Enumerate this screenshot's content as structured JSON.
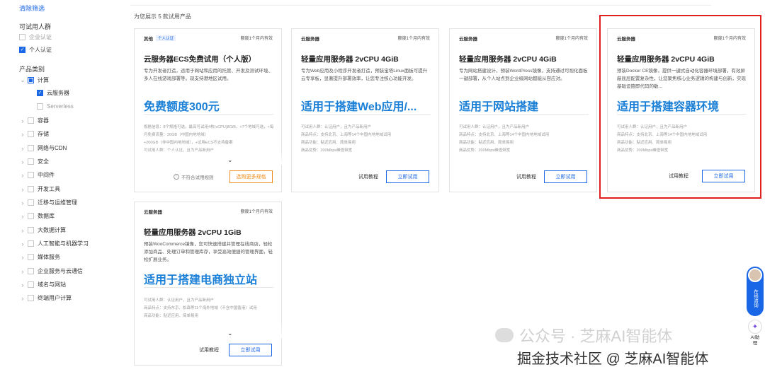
{
  "sidebar": {
    "clear_filters": "清除筛选",
    "audience_title": "可试用人群",
    "audience": [
      {
        "label": "企业认证",
        "checked": false
      },
      {
        "label": "个人认证",
        "checked": true
      }
    ],
    "category_title": "产品类别",
    "compute": {
      "label": "计算",
      "children": [
        {
          "label": "云服务器",
          "checked": true
        },
        {
          "label": "Serverless",
          "checked": false
        }
      ]
    },
    "categories": [
      "容器",
      "存储",
      "网络与CDN",
      "安全",
      "中间件",
      "开发工具",
      "迁移与运维管理",
      "数据库",
      "大数据计算",
      "人工智能与机器学习",
      "媒体服务",
      "企业服务与云通信",
      "域名与网站",
      "终端用户计算"
    ]
  },
  "content": {
    "count_text": "为您展示 5 款试用产品",
    "cards": [
      {
        "category": "其他",
        "tag": "个人认证",
        "quota": "额度1个月内有效",
        "title": "云服务器ECS免费试用（个人版）",
        "desc": "专为开发者打造，适用于网站和应用的托管、开发及测试环境、多人在线游戏部署等。现支持港地区试用。",
        "headline": "免费额度300元",
        "features": [
          "规格信息：8个规格可选，最高可试用4核(vCPU)8GiB，+7个地域可选，+每月免费流量：20GB（中国内地地域）",
          "+200GB（非中国内地地域），+试用ECS不支持备案",
          "可试用人群：个人认证，且为产品新用户"
        ],
        "rules_link": "不符合试用规则",
        "action": "选购更多规格"
      },
      {
        "category": "云服务器",
        "quota": "额度1个月内有效",
        "title": "轻量应用服务器 2vCPU 4GiB",
        "desc": "专为Web应用及小程序开发者打造，预装宝塔Linux面板可提升云专享板，显著提升部署效率，让您专注核心功能开发。",
        "headline": "适用于搭建Web应用/...",
        "features": [
          "可试用人群：认证用户，且为产品新用户",
          "商品特点：支持北京、上海等14个中国内地地域试用",
          "商品功能：贴近应用、简单易用",
          "商品优势：200Mbps峰值带宽"
        ],
        "guide": "试用教程",
        "action": "立即试用"
      },
      {
        "category": "云服务器",
        "quota": "额度1个月内有效",
        "title": "轻量应用服务器 2vCPU 4GiB",
        "desc": "专为网站搭建设计，预装WordPress镜像，支持通过可视化面板一键部署，从个人站点到企业级网站都能从容应对。",
        "headline": "适用于网站搭建",
        "features": [
          "可试用人群：认证用户，且为产品新用户",
          "商品特点：支持北京、上海等14个中国内地地域试用",
          "商品功能：贴近应用、简单易用",
          "商品优势：200Mbps峰值带宽"
        ],
        "guide": "试用教程",
        "action": "立即试用"
      },
      {
        "category": "云服务器",
        "quota": "额度1个月内有效",
        "title": "轻量应用服务器 2vCPU 4GiB",
        "desc": "预装Docker CE镜像，提供一键式自动化容器环境部署，有效屏蔽底层配置复杂性，让您聚焦核心业务逻辑的构建与创新，实现基础设施即代码的敏...",
        "headline": "适用于搭建容器环境",
        "features": [
          "可试用人群：认证用户，且为产品新用户",
          "商品特点：支持北京、上海等14个中国内地地域试用",
          "商品功能：贴近应用、简单易用",
          "商品优势：200Mbps峰值带宽"
        ],
        "guide": "试用教程",
        "action": "立即试用"
      },
      {
        "category": "云服务器",
        "quota": "额度1个月内有效",
        "title": "轻量应用服务器 2vCPU 1GiB",
        "desc": "预装WooCommerce镜像，您可快速搭建并管理在线商店，轻松添加商品、处理订单和管理库存，享受高效便捷的管理界面，轻松扩展业务。",
        "headline": "适用于搭建电商独立站",
        "features": [
          "可试用人群：认证用户，且为产品新用户",
          "商品特点：支持东京、松森等11个海外地域（不含中国香港）试用",
          "商品功能：贴近应用、简单易用"
        ],
        "guide": "试用教程",
        "action": "立即试用"
      }
    ]
  },
  "float_widget": {
    "consult": "在线咨询",
    "ai": "AI助理"
  },
  "watermark": {
    "line1": "公众号 · 芝麻AI智能体",
    "line2": "掘金技术社区 @ 芝麻AI智能体"
  },
  "colors": {
    "accent": "#1966e6",
    "headline": "#1a7fd6",
    "highlight_border": "#e02020",
    "orange": "#f08c1e"
  }
}
